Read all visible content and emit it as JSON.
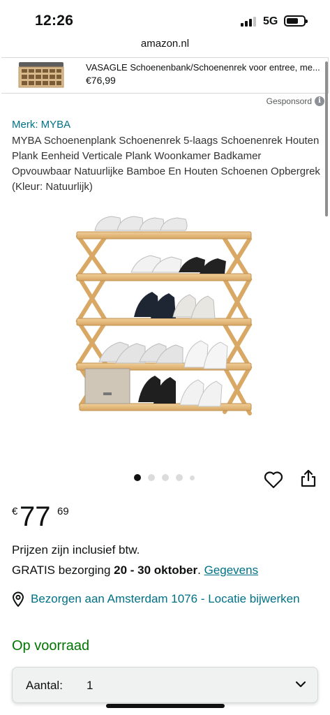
{
  "status_bar": {
    "time": "12:26",
    "network": "5G",
    "signal_bars_active": 3,
    "signal_bars_total": 4,
    "battery_level": 0.65
  },
  "browser": {
    "url": "amazon.nl"
  },
  "ad_banner": {
    "title": "VASAGLE Schoenenbank/Schoenenrek voor entree, me...",
    "price": "€76,99",
    "thumbnail_icon": "shoe-bench-thumbnail"
  },
  "sponsored": {
    "label": "Gesponsord",
    "icon": "info-icon",
    "icon_glyph": "i"
  },
  "product": {
    "brand": "Merk: MYBA",
    "title": "MYBA Schoenenplank Schoenenrek 5-laags Schoenenrek Houten Plank Eenheid Verticale Plank Woonkamer Badkamer Opvouwbaar Natuurlijke Bamboe En Houten Schoenen Opbergrek (Kleur: Natuurlijk)",
    "image_icon": "bamboe-shoe-rack-image",
    "carousel": {
      "total": 5,
      "active_index": 0
    },
    "actions": {
      "favorite_icon": "heart-icon",
      "share_icon": "share-icon"
    }
  },
  "price": {
    "currency": "€",
    "whole": "77",
    "fraction": "69"
  },
  "vat_note": "Prijzen zijn inclusief btw.",
  "delivery": {
    "prefix": "GRATIS bezorging ",
    "dates": "20 - 30 oktober",
    "suffix": ". ",
    "details_link": "Gegevens"
  },
  "location": {
    "icon": "location-pin-icon",
    "text": "Bezorgen aan Amsterdam 1076 - Locatie bijwerken"
  },
  "stock_status": "Op voorraad",
  "quantity": {
    "label": "Aantal:",
    "value": "1",
    "icon": "chevron-down-icon"
  },
  "colors": {
    "link": "#007185",
    "in_stock": "#007600",
    "text": "#0f1111",
    "bamboo": "#e3b877"
  }
}
